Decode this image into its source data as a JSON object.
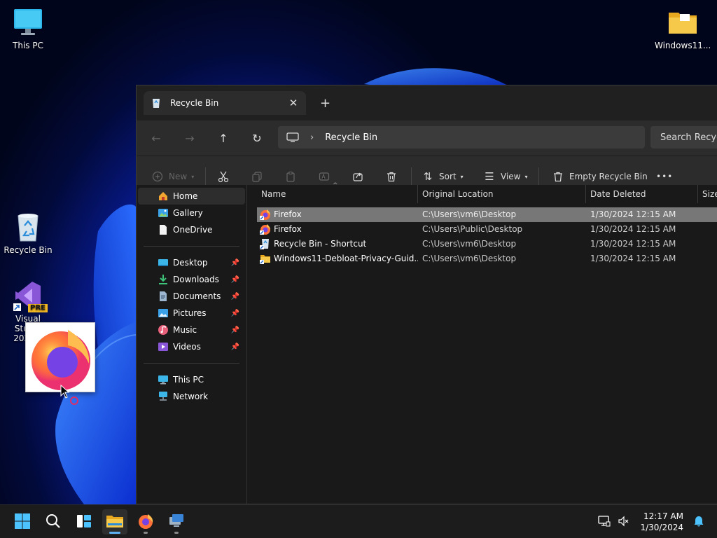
{
  "desktop": {
    "icons": [
      {
        "label": "This PC"
      },
      {
        "label": "Recycle Bin"
      },
      {
        "label": "Visual Studio 2022 P",
        "badge": "PRE"
      },
      {
        "label": "Windows11..."
      }
    ]
  },
  "explorer": {
    "tab_title": "Recycle Bin",
    "close_glyph": "✕",
    "newtab_glyph": "+",
    "address": {
      "crumb": "Recycle Bin",
      "chevron": "›"
    },
    "search_placeholder": "Search Recycle Bin",
    "toolbar": {
      "new": "New",
      "sort": "Sort",
      "view": "View",
      "empty": "Empty Recycle Bin",
      "more": "•••"
    },
    "sidebar": {
      "home": "Home",
      "gallery": "Gallery",
      "onedrive": "OneDrive",
      "desktop": "Desktop",
      "downloads": "Downloads",
      "documents": "Documents",
      "pictures": "Pictures",
      "music": "Music",
      "videos": "Videos",
      "thispc": "This PC",
      "network": "Network"
    },
    "columns": {
      "name": "Name",
      "location": "Original Location",
      "date": "Date Deleted",
      "size": "Size"
    },
    "rows": [
      {
        "name": "Firefox",
        "location": "C:\\Users\\vm6\\Desktop",
        "date": "1/30/2024 12:15 AM"
      },
      {
        "name": "Firefox",
        "location": "C:\\Users\\Public\\Desktop",
        "date": "1/30/2024 12:15 AM"
      },
      {
        "name": "Recycle Bin - Shortcut",
        "location": "C:\\Users\\vm6\\Desktop",
        "date": "1/30/2024 12:15 AM"
      },
      {
        "name": "Windows11-Debloat-Privacy-Guid...",
        "location": "C:\\Users\\vm6\\Desktop",
        "date": "1/30/2024 12:15 AM"
      }
    ]
  },
  "taskbar": {
    "time": "12:17 AM",
    "date": "1/30/2024"
  },
  "colors": {
    "accent": "#5fb2f2",
    "selection": "#777777",
    "window_bg": "#191919"
  }
}
